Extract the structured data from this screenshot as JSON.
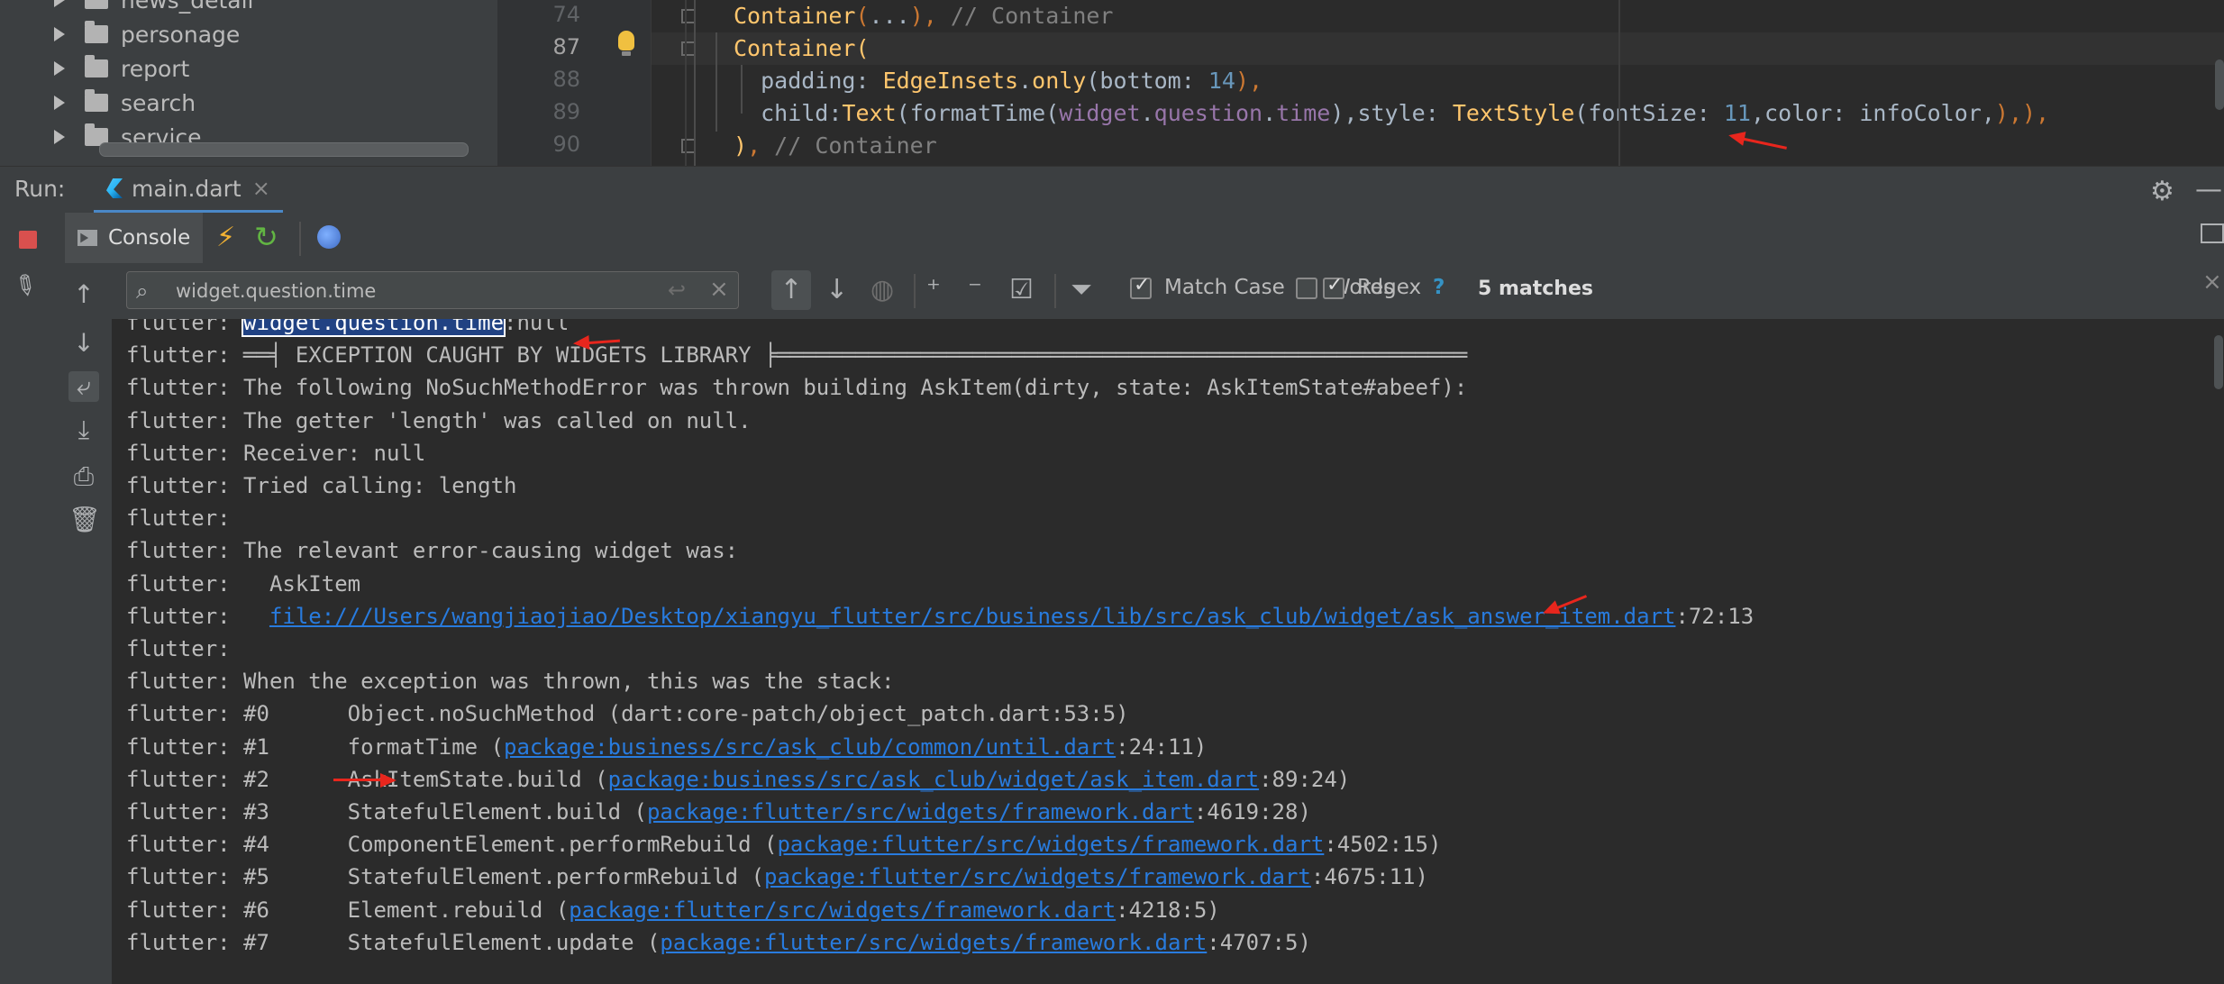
{
  "project_tree": {
    "items": [
      {
        "label": "news_detail"
      },
      {
        "label": "personage"
      },
      {
        "label": "report"
      },
      {
        "label": "search"
      },
      {
        "label": "service"
      }
    ]
  },
  "editor": {
    "line_numbers": [
      "74",
      "87",
      "88",
      "89",
      "90"
    ],
    "lines": [
      {
        "parts": [
          {
            "t": "Container",
            "k": "c-class"
          },
          {
            "t": "(",
            "k": "c-punct"
          },
          {
            "t": "...",
            "k": ""
          },
          {
            "t": ")",
            "k": "c-punct"
          },
          {
            "t": ", ",
            "k": "c-punct"
          },
          {
            "t": "// Container",
            "k": "c-comment"
          }
        ]
      },
      {
        "parts": [
          {
            "t": "Container",
            "k": "c-class"
          },
          {
            "t": "(",
            "k": "c-class"
          }
        ]
      },
      {
        "parts": [
          {
            "t": "  padding: ",
            "k": ""
          },
          {
            "t": "EdgeInsets",
            "k": "c-class"
          },
          {
            "t": ".",
            "k": ""
          },
          {
            "t": "only",
            "k": "c-class"
          },
          {
            "t": "(bottom: ",
            "k": ""
          },
          {
            "t": "14",
            "k": "c-num"
          },
          {
            "t": "),",
            "k": "c-punct"
          }
        ]
      },
      {
        "parts": [
          {
            "t": "  child:",
            "k": ""
          },
          {
            "t": "Text",
            "k": "c-class"
          },
          {
            "t": "(formatTime(",
            "k": ""
          },
          {
            "t": "widget",
            "k": "c-field"
          },
          {
            "t": ".",
            "k": ""
          },
          {
            "t": "question",
            "k": "c-field"
          },
          {
            "t": ".",
            "k": ""
          },
          {
            "t": "time",
            "k": "c-field"
          },
          {
            "t": "),style: ",
            "k": ""
          },
          {
            "t": "TextStyle",
            "k": "c-class"
          },
          {
            "t": "(fontSize: ",
            "k": ""
          },
          {
            "t": "11",
            "k": "c-num"
          },
          {
            "t": ",color: infoColor,",
            "k": ""
          },
          {
            "t": "),),",
            "k": "c-punct"
          }
        ]
      },
      {
        "parts": [
          {
            "t": ")",
            "k": "c-class"
          },
          {
            "t": ", ",
            "k": "c-punct"
          },
          {
            "t": "// Container",
            "k": "c-comment"
          }
        ]
      }
    ]
  },
  "run_bar": {
    "label": "Run:",
    "tab_label": "main.dart",
    "close_glyph": "×"
  },
  "console_toolbar": {
    "console_label": "Console"
  },
  "search": {
    "query": "widget.question.time",
    "options": [
      {
        "label": "Match Case",
        "checked": true
      },
      {
        "label": "Words",
        "checked": false
      },
      {
        "label": "Regex",
        "checked": true
      }
    ],
    "help": "?",
    "match_count": "5 matches"
  },
  "console": {
    "lines": [
      [
        {
          "t": "flutter: "
        },
        {
          "t": "widget.question.time",
          "k": "hl"
        },
        {
          "t": ":null"
        }
      ],
      [
        {
          "t": "flutter: ══╡ EXCEPTION CAUGHT BY WIDGETS LIBRARY ╞═════════════════════════════════════════════════════"
        }
      ],
      [
        {
          "t": "flutter: The following NoSuchMethodError was thrown building AskItem(dirty, state: AskItemState#abeef):"
        }
      ],
      [
        {
          "t": "flutter: The getter 'length' was called on null."
        }
      ],
      [
        {
          "t": "flutter: Receiver: null"
        }
      ],
      [
        {
          "t": "flutter: Tried calling: length"
        }
      ],
      [
        {
          "t": "flutter:"
        }
      ],
      [
        {
          "t": "flutter: The relevant error-causing widget was:"
        }
      ],
      [
        {
          "t": "flutter:   AskItem"
        }
      ],
      [
        {
          "t": "flutter:   "
        },
        {
          "t": "file:///Users/wangjiaojiao/Desktop/xiangyu_flutter/src/business/lib/src/ask_club/widget/ask_answer_item.dart",
          "k": "link"
        },
        {
          "t": ":72:13"
        }
      ],
      [
        {
          "t": "flutter:"
        }
      ],
      [
        {
          "t": "flutter: When the exception was thrown, this was the stack:"
        }
      ],
      [
        {
          "t": "flutter: #0      Object.noSuchMethod (dart:core-patch/object_patch.dart:53:5)"
        }
      ],
      [
        {
          "t": "flutter: #1      formatTime ("
        },
        {
          "t": "package:business/src/ask_club/common/until.dart",
          "k": "link"
        },
        {
          "t": ":24:11)"
        }
      ],
      [
        {
          "t": "flutter: #2      AskItemState.build ("
        },
        {
          "t": "package:business/src/ask_club/widget/ask_item.dart",
          "k": "link"
        },
        {
          "t": ":89:24)"
        }
      ],
      [
        {
          "t": "flutter: #3      StatefulElement.build ("
        },
        {
          "t": "package:flutter/src/widgets/framework.dart",
          "k": "link"
        },
        {
          "t": ":4619:28)"
        }
      ],
      [
        {
          "t": "flutter: #4      ComponentElement.performRebuild ("
        },
        {
          "t": "package:flutter/src/widgets/framework.dart",
          "k": "link"
        },
        {
          "t": ":4502:15)"
        }
      ],
      [
        {
          "t": "flutter: #5      StatefulElement.performRebuild ("
        },
        {
          "t": "package:flutter/src/widgets/framework.dart",
          "k": "link"
        },
        {
          "t": ":4675:11)"
        }
      ],
      [
        {
          "t": "flutter: #6      Element.rebuild ("
        },
        {
          "t": "package:flutter/src/widgets/framework.dart",
          "k": "link"
        },
        {
          "t": ":4218:5)"
        }
      ],
      [
        {
          "t": "flutter: #7      StatefulElement.update ("
        },
        {
          "t": "package:flutter/src/widgets/framework.dart",
          "k": "link"
        },
        {
          "t": ":4707:5)"
        }
      ]
    ]
  },
  "colors": {
    "accent": "#4a88c7",
    "link": "#287bde",
    "annotation": "#e8261d",
    "stop": "#d9504e"
  },
  "icons": [
    "dart-file-icon",
    "console-icon",
    "hot-reload-icon",
    "hot-restart-icon",
    "devtools-icon",
    "gear-icon",
    "minimize-icon",
    "stop-icon",
    "pin-icon",
    "search-icon",
    "up-arrow-icon",
    "down-arrow-icon",
    "filter-icon"
  ]
}
